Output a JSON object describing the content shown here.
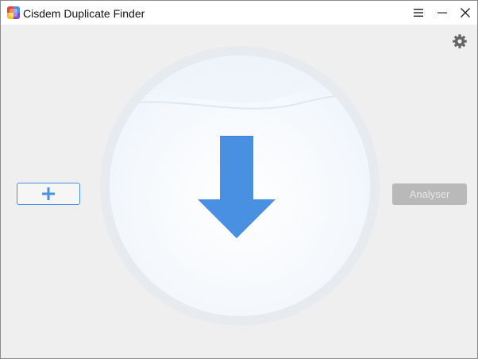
{
  "window": {
    "title": "Cisdem Duplicate Finder",
    "icons": [
      "app-logo-icon",
      "menu-icon",
      "minimize-icon",
      "close-icon"
    ]
  },
  "toolbar": {
    "settings_icon": "gear-icon"
  },
  "main": {
    "add_button_icon": "plus-icon",
    "analyse_button_label": "Analyser",
    "drop_zone_icon": "download-arrow-icon"
  },
  "colors": {
    "accent": "#4a90e2",
    "disabled_button": "#b9b9b9",
    "background": "#efefef"
  }
}
